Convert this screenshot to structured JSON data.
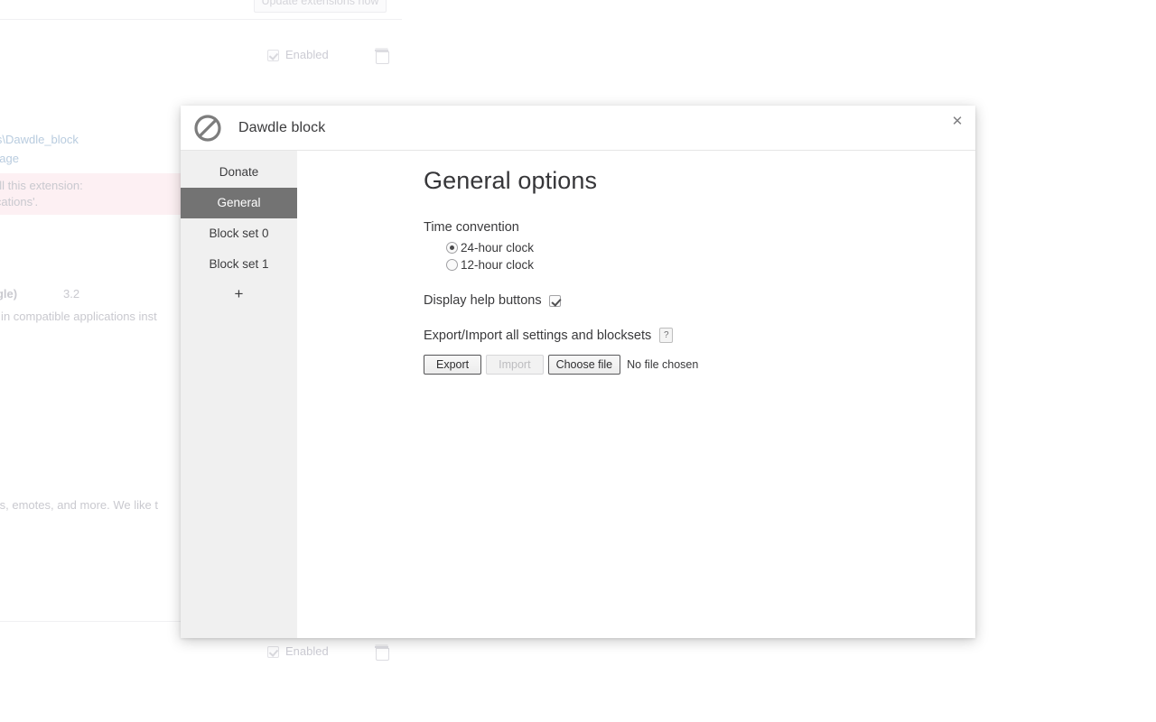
{
  "background": {
    "update_button_label": "Update extensions now",
    "rows": [
      {
        "checkbox_label": "Enabled",
        "trash_icon": "trash-icon"
      },
      {
        "checkbox_label": "Enabled",
        "trash_icon": "trash-icon"
      }
    ],
    "texts": [
      "sions\\Dawdle_block",
      "page",
      "all this extension:",
      "ications'.",
      "Google)",
      "3.2",
      "wser in compatible applications inst",
      "atures, emotes, and more. We like t"
    ]
  },
  "modal": {
    "logo_icon": "prohibition-sign-icon",
    "title": "Dawdle block",
    "close_label": "✕",
    "sidebar": {
      "items": [
        {
          "label": "Donate",
          "active": false
        },
        {
          "label": "General",
          "active": true
        },
        {
          "label": "Block set 0",
          "active": false
        },
        {
          "label": "Block set 1",
          "active": false
        }
      ],
      "add_label": "+"
    },
    "content": {
      "heading": "General options",
      "time_convention": {
        "label": "Time convention",
        "options": [
          {
            "label": "24-hour clock",
            "selected": true
          },
          {
            "label": "12-hour clock",
            "selected": false
          }
        ]
      },
      "display_help_buttons": {
        "label": "Display help buttons",
        "checked": true
      },
      "export_import": {
        "label": "Export/Import all settings and blocksets",
        "help_badge": "?",
        "export_label": "Export",
        "import_label": "Import",
        "choose_file_label": "Choose file",
        "file_status": "No file chosen"
      }
    }
  },
  "colors": {
    "sidebar_bg": "#f0f0f0",
    "sidebar_active_bg": "#737373",
    "text": "#3a3a3c",
    "warning_bg": "#fdf0f3"
  }
}
